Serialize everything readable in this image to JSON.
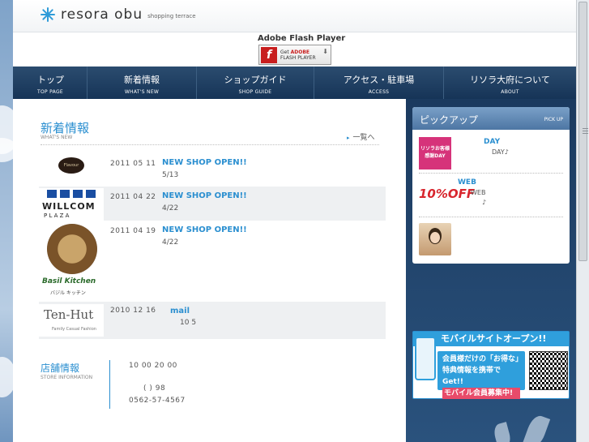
{
  "header": {
    "logo_text": "resora obu",
    "logo_sub": "shopping terrace",
    "flash_title": "Adobe Flash Player",
    "flash_get": "Get",
    "flash_adobe": "ADOBE",
    "flash_player": "FLASH PLAYER"
  },
  "nav": [
    {
      "jp": "トップ",
      "en": "TOP PAGE"
    },
    {
      "jp": "新着情報",
      "en": "WHAT'S NEW"
    },
    {
      "jp": "ショップガイド",
      "en": "SHOP GUIDE"
    },
    {
      "jp": "アクセス・駐車場",
      "en": "ACCESS"
    },
    {
      "jp": "リソラ大府について",
      "en": "ABOUT"
    }
  ],
  "news": {
    "title": "新着情報",
    "subtitle": "WHAT'S NEW",
    "more": "一覧へ",
    "items": [
      {
        "date": "2011 05 11",
        "headline": "NEW SHOP OPEN!!",
        "detail": "5/13",
        "thumb_label": "Flavour"
      },
      {
        "date": "2011 04 22",
        "headline": "NEW SHOP OPEN!!",
        "detail": "4/22",
        "thumb_label": "WILLCOM",
        "thumb_sub": "P L A Z A"
      },
      {
        "date": "2011 04 19",
        "headline": "NEW SHOP OPEN!!",
        "detail": "4/22",
        "thumb_label": "Basil Kitchen",
        "thumb_sub": "バジル キッチン"
      },
      {
        "date": "2010 12 16",
        "headline": "mail",
        "detail": "10  5",
        "thumb_label": "Ten-Hut",
        "thumb_sub": "Family Casual Fashion"
      }
    ]
  },
  "store": {
    "title": "店舗情報",
    "subtitle": "STORE INFORMATION",
    "line1": "10 00 20 00",
    "line2": "(      ) 98",
    "line3": "0562-57-4567"
  },
  "pickup": {
    "title": "ピックアップ",
    "subtitle": "PICK UP",
    "items": [
      {
        "title": "DAY",
        "desc": "DAY♪",
        "img_text": "リソラお客様感謝DAY"
      },
      {
        "title": "WEB",
        "desc": "WEB",
        "desc2": "♪",
        "img_text": "10%OFF"
      },
      {
        "title": "",
        "desc": "",
        "img_text": ""
      }
    ]
  },
  "mobile": {
    "head": "モバイルサイトオープン!!",
    "line1": "会員様だけの「お得な」",
    "line2": "特典情報を携帯でGet!!",
    "line3": "モバイル会員募集中!"
  },
  "colors": {
    "accent": "#2b8fd0",
    "nav_bg": "#1f3f63",
    "sidebar_bg": "#1b3a5f"
  }
}
